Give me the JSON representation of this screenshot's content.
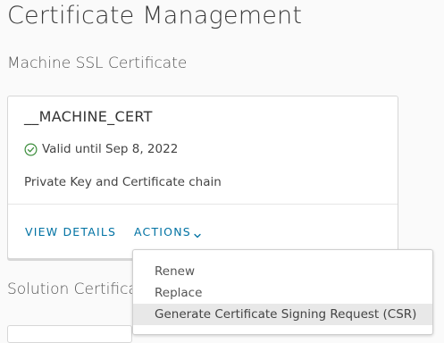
{
  "page": {
    "title": "Certificate Management"
  },
  "machine_ssl": {
    "section_title": "Machine SSL Certificate",
    "card": {
      "name": "__MACHINE_CERT",
      "status_icon": "check-circle-icon",
      "status_color": "#3c8d3c",
      "validity": "Valid until Sep 8, 2022",
      "description": "Private Key and Certificate chain",
      "view_details_label": "VIEW DETAILS",
      "actions_label": "ACTIONS",
      "actions_icon": "chevron-down-icon"
    }
  },
  "actions_menu": {
    "items": [
      {
        "label": "Renew"
      },
      {
        "label": "Replace"
      },
      {
        "label": "Generate Certificate Signing Request (CSR)"
      }
    ],
    "hovered_index": 2
  },
  "solution": {
    "section_title": "Solution Certificates"
  },
  "colors": {
    "link": "#0072a3",
    "hover_bg": "#e8e8e8"
  }
}
